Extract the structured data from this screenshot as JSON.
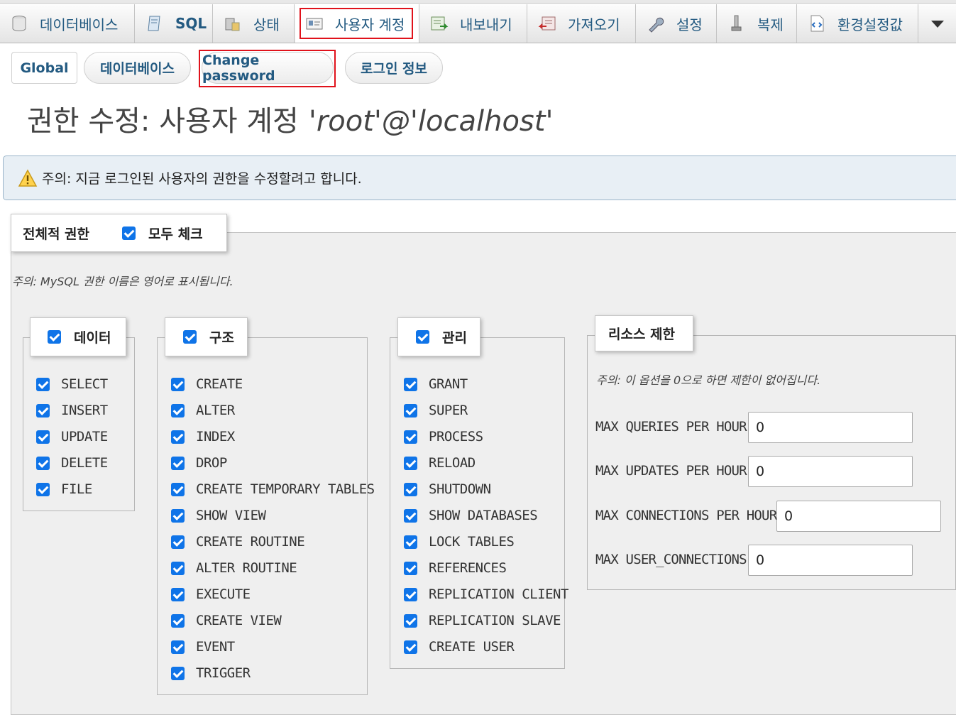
{
  "top_tabs": [
    {
      "label": "데이터베이스",
      "icon": "database-icon"
    },
    {
      "label": "SQL",
      "icon": "sql-icon"
    },
    {
      "label": "상태",
      "icon": "status-icon"
    },
    {
      "label": "사용자 계정",
      "icon": "user-card-icon",
      "active": true
    },
    {
      "label": "내보내기",
      "icon": "export-icon"
    },
    {
      "label": "가져오기",
      "icon": "import-icon"
    },
    {
      "label": "설정",
      "icon": "wrench-icon"
    },
    {
      "label": "복제",
      "icon": "replication-icon"
    },
    {
      "label": "환경설정값",
      "icon": "variables-icon"
    }
  ],
  "sub_tabs": [
    "Global",
    "데이터베이스",
    "Change password",
    "로그인 정보"
  ],
  "title": {
    "main": "권한 수정: 사용자 계정",
    "account": "'root'@'localhost'"
  },
  "notice": "주의: 지금 로그인된 사용자의 권한을 수정할려고 합니다.",
  "global": {
    "legend": "전체적 권한",
    "check_all": "모두 체크",
    "note": "주의: MySQL 권한 이름은 영어로 표시됩니다."
  },
  "groups": {
    "data": {
      "legend": "데이터",
      "items": [
        "SELECT",
        "INSERT",
        "UPDATE",
        "DELETE",
        "FILE"
      ]
    },
    "structure": {
      "legend": "구조",
      "items": [
        "CREATE",
        "ALTER",
        "INDEX",
        "DROP",
        "CREATE TEMPORARY TABLES",
        "SHOW VIEW",
        "CREATE ROUTINE",
        "ALTER ROUTINE",
        "EXECUTE",
        "CREATE VIEW",
        "EVENT",
        "TRIGGER"
      ]
    },
    "admin": {
      "legend": "관리",
      "items": [
        "GRANT",
        "SUPER",
        "PROCESS",
        "RELOAD",
        "SHUTDOWN",
        "SHOW DATABASES",
        "LOCK TABLES",
        "REFERENCES",
        "REPLICATION CLIENT",
        "REPLICATION SLAVE",
        "CREATE USER"
      ]
    }
  },
  "resources": {
    "legend": "리소스 제한",
    "note": "주의: 이 옵션을 0으로 하면 제한이 없어집니다.",
    "fields": [
      {
        "label": "MAX QUERIES PER HOUR",
        "value": "0"
      },
      {
        "label": "MAX UPDATES PER HOUR",
        "value": "0"
      },
      {
        "label": "MAX CONNECTIONS PER HOUR",
        "value": "0"
      },
      {
        "label": "MAX USER_CONNECTIONS",
        "value": "0"
      }
    ]
  },
  "colors": {
    "accent": "#235a81",
    "checkbox": "#0f74e8",
    "highlight": "#e0121b"
  }
}
